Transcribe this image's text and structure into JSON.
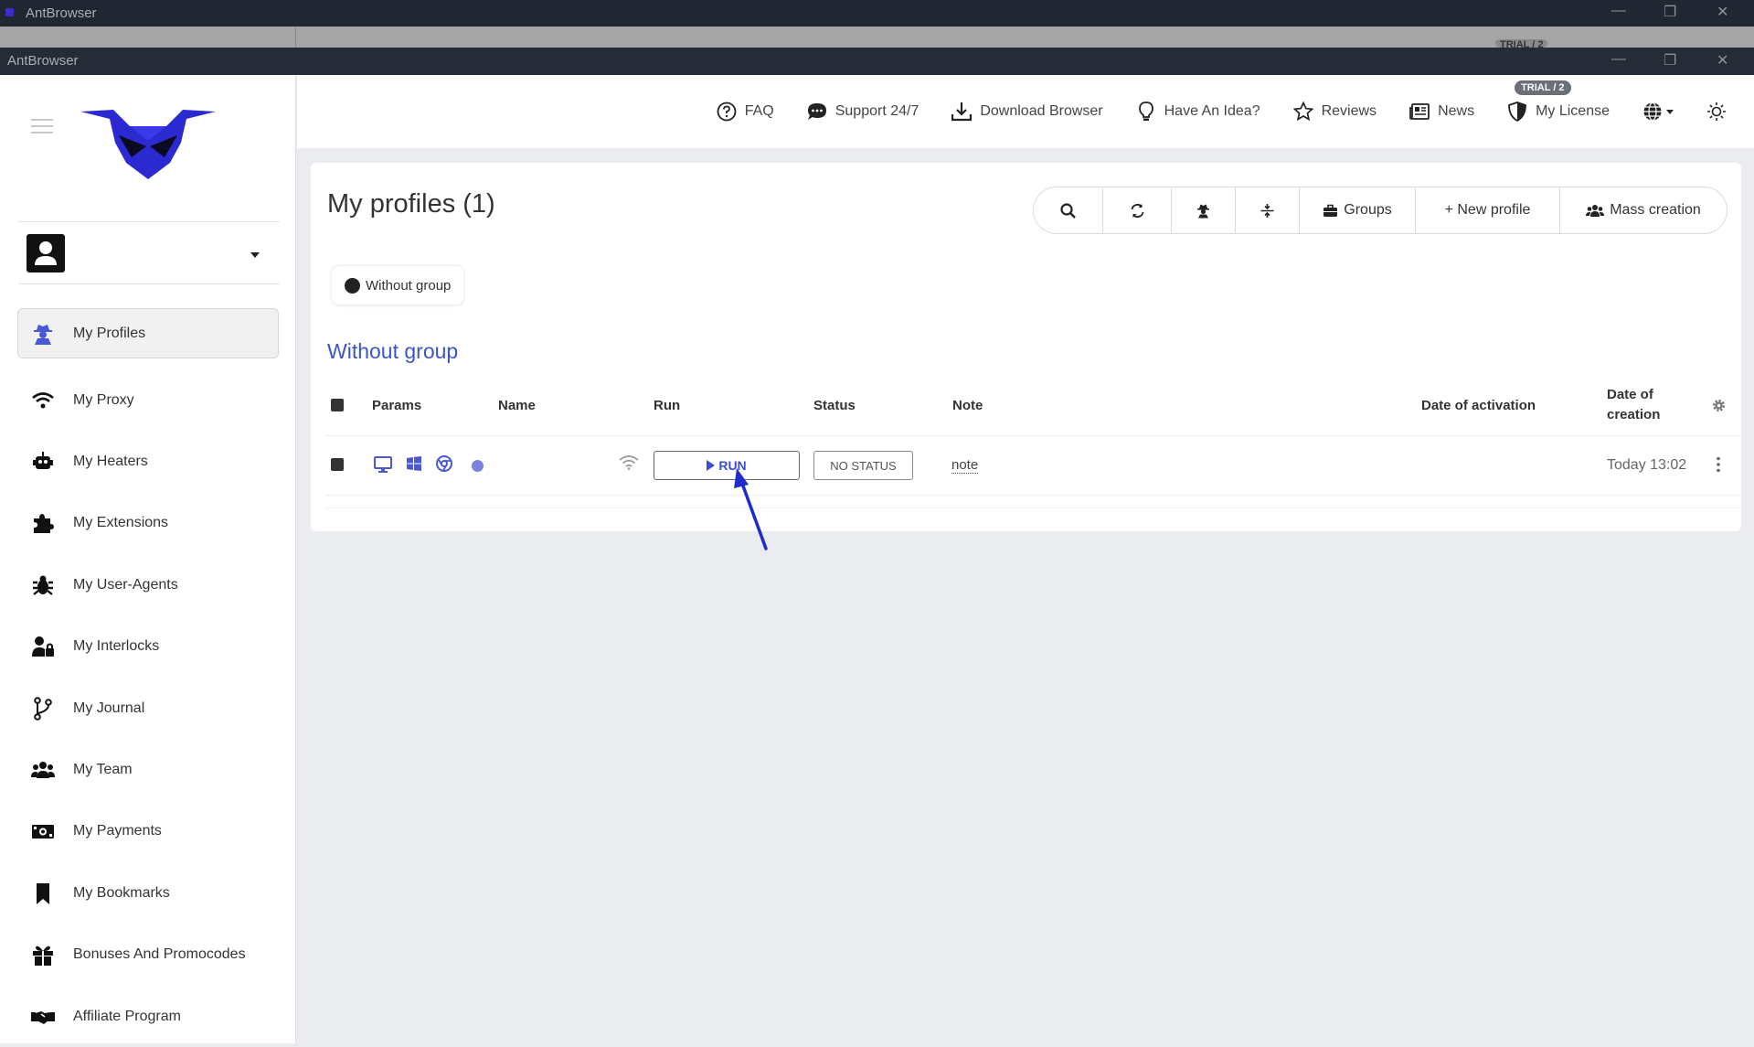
{
  "window": {
    "title_back": "AntBrowser",
    "title_front": "AntBrowser",
    "ghost_badge": "TRIAL / 2",
    "minimize": "—",
    "restore": "❐",
    "close": "✕"
  },
  "sidebar": {
    "items": [
      {
        "label": "My Profiles",
        "icon": "user-secret-icon"
      },
      {
        "label": "My Proxy",
        "icon": "wifi-icon"
      },
      {
        "label": "My Heaters",
        "icon": "robot-icon"
      },
      {
        "label": "My Extensions",
        "icon": "puzzle-icon"
      },
      {
        "label": "My User-Agents",
        "icon": "bug-icon"
      },
      {
        "label": "My Interlocks",
        "icon": "user-lock-icon"
      },
      {
        "label": "My Journal",
        "icon": "code-branch-icon"
      },
      {
        "label": "My Team",
        "icon": "users-icon"
      },
      {
        "label": "My Payments",
        "icon": "money-bill-icon"
      },
      {
        "label": "My Bookmarks",
        "icon": "bookmark-icon"
      },
      {
        "label": "Bonuses And Promocodes",
        "icon": "gift-icon"
      },
      {
        "label": "Affiliate Program",
        "icon": "handshake-icon"
      }
    ]
  },
  "topnav": {
    "faq": "FAQ",
    "support": "Support 24/7",
    "download": "Download Browser",
    "idea": "Have An Idea?",
    "reviews": "Reviews",
    "news": "News",
    "license": "My License",
    "trial_badge": "TRIAL / 2"
  },
  "main": {
    "title": "My profiles (1)",
    "toolbar": {
      "groups": "Groups",
      "new_profile": "+ New profile",
      "mass_creation": "Mass creation"
    },
    "group_chip": "Without group",
    "group_title": "Without group",
    "table": {
      "headers": {
        "params": "Params",
        "name": "Name",
        "run": "Run",
        "status": "Status",
        "note": "Note",
        "activation": "Date of activation",
        "creation_line1": "Date of",
        "creation_line2": "creation"
      },
      "rows": [
        {
          "name": "",
          "run_label": "RUN",
          "status": "NO STATUS",
          "note": "note",
          "date_activation": "",
          "date_creation": "Today 13:02"
        }
      ]
    }
  },
  "colors": {
    "accent": "#3d4fd0",
    "link": "#3a56c8",
    "arrow": "#1f2ccc"
  }
}
